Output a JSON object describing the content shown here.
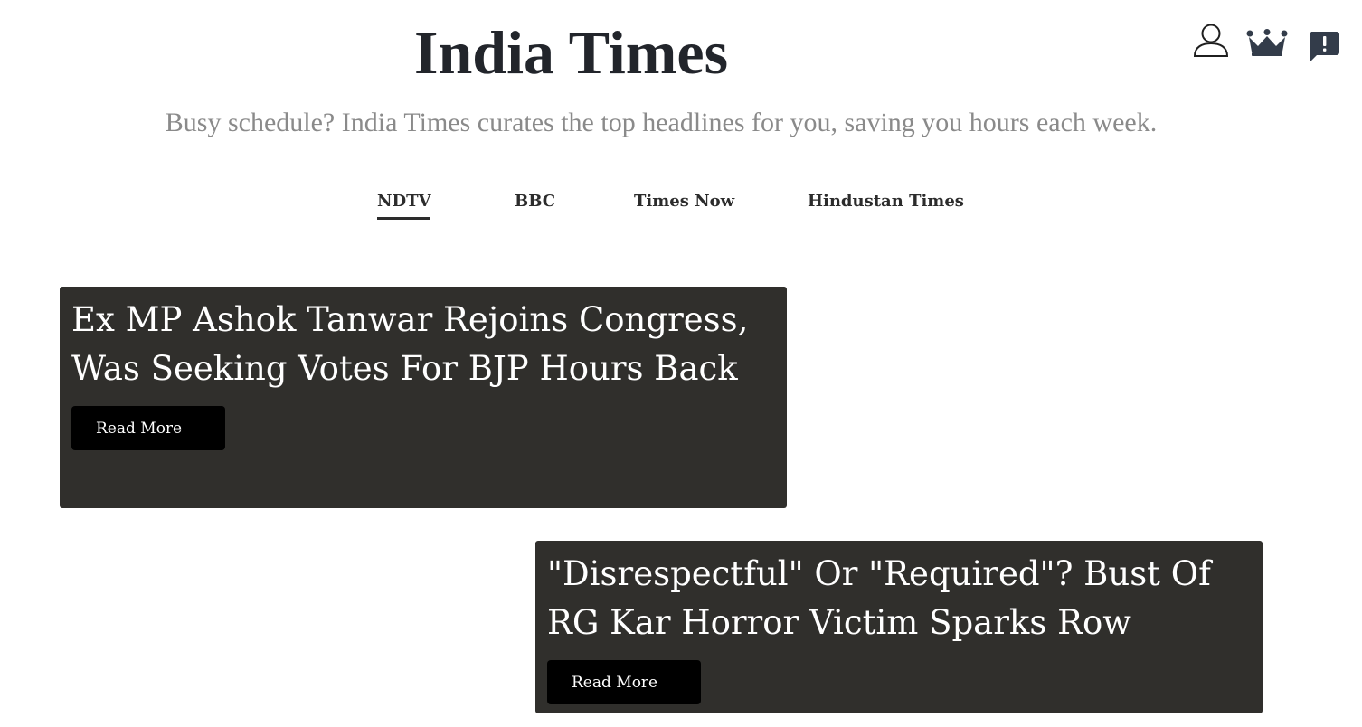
{
  "header": {
    "title": "India Times",
    "tagline": "Busy schedule? India Times curates the top headlines for you, saving you hours each week."
  },
  "header_icons": [
    {
      "icon": "user-icon"
    },
    {
      "icon": "crown-icon"
    },
    {
      "icon": "feedback-icon"
    }
  ],
  "nav": {
    "tabs": [
      {
        "label": "NDTV",
        "active": true
      },
      {
        "label": "BBC",
        "active": false
      },
      {
        "label": "Times Now",
        "active": false
      },
      {
        "label": "Hindustan Times",
        "active": false
      }
    ]
  },
  "articles": [
    {
      "headline": "Ex MP Ashok Tanwar Rejoins Congress, Was Seeking Votes For BJP Hours Back",
      "button_label": "Read More"
    },
    {
      "headline": "\"Disrespectful\" Or \"Required\"? Bust Of RG Kar Horror Victim Sparks Row",
      "button_label": "Read More"
    }
  ],
  "colors": {
    "title": "#22252b",
    "tagline": "#8a8a8a",
    "card_background": "#302f2c",
    "button_background": "#000000",
    "icon": "#333c4a"
  }
}
